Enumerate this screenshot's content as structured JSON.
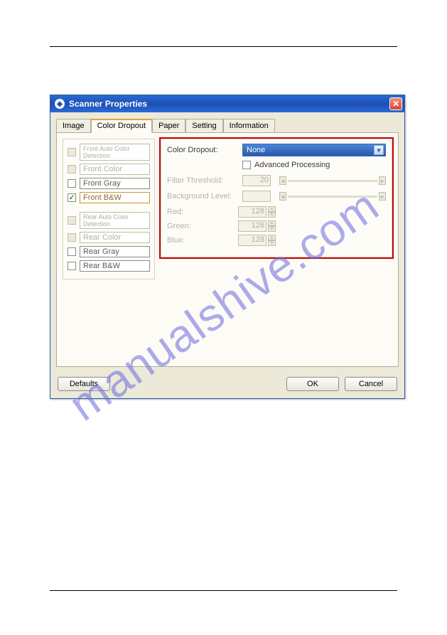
{
  "watermark": "manualshive.com",
  "window": {
    "title": "Scanner Properties"
  },
  "tabs": [
    "Image",
    "Color Dropout",
    "Paper",
    "Setting",
    "Information"
  ],
  "activeTabIndex": 1,
  "left": {
    "frontAuto": "Front Auto Color Detection",
    "frontColor": "Front Color",
    "frontGray": "Front Gray",
    "frontBW": "Front B&W",
    "rearAuto": "Rear Auto Color Detection",
    "rearColor": "Rear Color",
    "rearGray": "Rear Gray",
    "rearBW": "Rear B&W"
  },
  "right": {
    "colorDropoutLabel": "Color Dropout:",
    "colorDropoutValue": "None",
    "advanced": "Advanced Processing",
    "filterThreshold": "Filter Threshold:",
    "filterValue": "20",
    "backgroundLevel": "Background Level:",
    "red": "Red:",
    "green": "Green:",
    "blue": "Blue:",
    "rgbValue": "128"
  },
  "buttons": {
    "defaults": "Defaults",
    "ok": "OK",
    "cancel": "Cancel"
  }
}
